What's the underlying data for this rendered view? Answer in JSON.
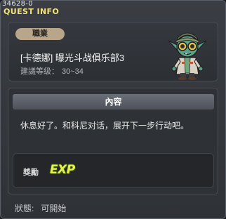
{
  "header": {
    "quest_id": "34628-0",
    "title": "QUEST INFO"
  },
  "info": {
    "job_badge": "職業",
    "quest_name": "[卡德娜] 曝光斗战俱乐部3",
    "level_label": "建議等级：",
    "level_range": "30~34"
  },
  "content": {
    "header": "內容",
    "text": "休息好了。和科尼对话，展开下一步行动吧。"
  },
  "reward": {
    "label": "獎勵",
    "exp_icon_text": "EXP",
    "icon": "exp-icon"
  },
  "status": {
    "label": "狀態:",
    "value": "可開始"
  }
}
